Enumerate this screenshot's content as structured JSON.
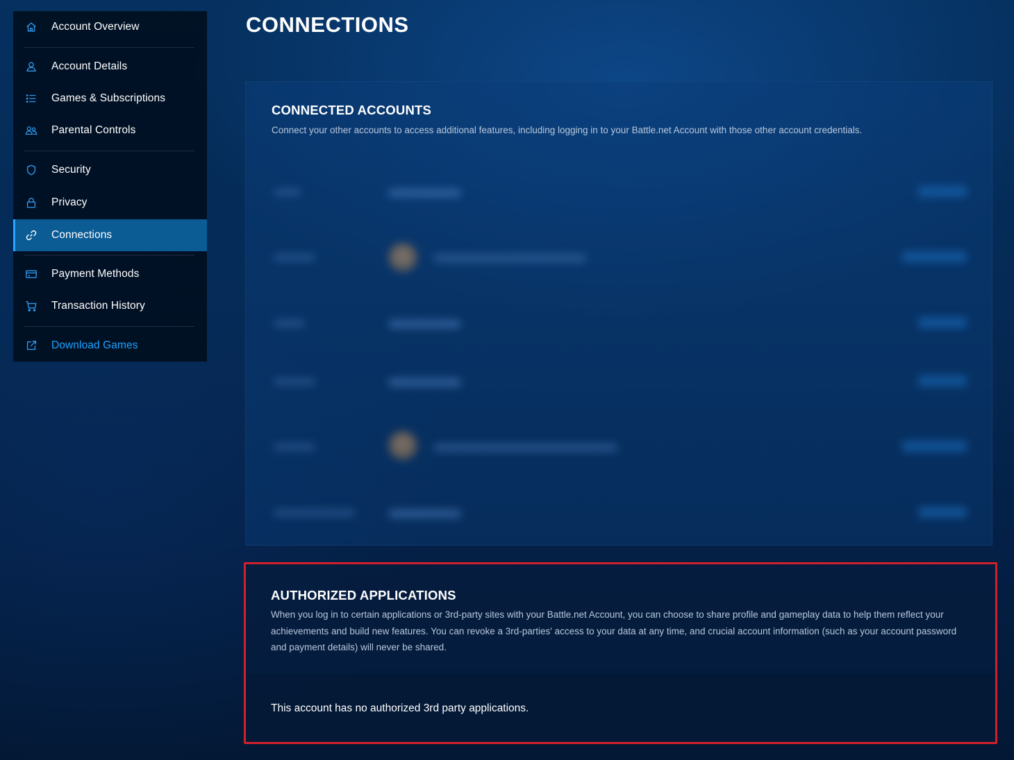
{
  "page": {
    "title": "CONNECTIONS"
  },
  "sidebar": {
    "items": [
      {
        "label": "Account Overview",
        "icon": "home-icon"
      },
      {
        "label": "Account Details",
        "icon": "user-icon"
      },
      {
        "label": "Games & Subscriptions",
        "icon": "list-icon"
      },
      {
        "label": "Parental Controls",
        "icon": "users-icon"
      },
      {
        "label": "Security",
        "icon": "shield-icon"
      },
      {
        "label": "Privacy",
        "icon": "lock-icon"
      },
      {
        "label": "Connections",
        "icon": "link-icon",
        "active": true
      },
      {
        "label": "Payment Methods",
        "icon": "credit-card-icon"
      },
      {
        "label": "Transaction History",
        "icon": "cart-icon"
      },
      {
        "label": "Download Games",
        "icon": "external-link-icon"
      }
    ]
  },
  "connected_accounts": {
    "title": "CONNECTED ACCOUNTS",
    "description": "Connect your other accounts to access additional features, including logging in to your Battle.net Account with those other account credentials."
  },
  "authorized_applications": {
    "title": "AUTHORIZED APPLICATIONS",
    "description": "When you log in to certain applications or 3rd-party sites with your Battle.net Account, you can choose to share profile and gameplay data to help them reflect your achievements and build new features. You can revoke a 3rd-parties' access to your data at any time, and crucial account information (such as your account password and payment details) will never be shared.",
    "empty_message": "This account has no authorized 3rd party applications."
  },
  "colors": {
    "accent": "#1ea2ff",
    "active_bg": "#0b5b95",
    "highlight_border": "#d3202b"
  }
}
